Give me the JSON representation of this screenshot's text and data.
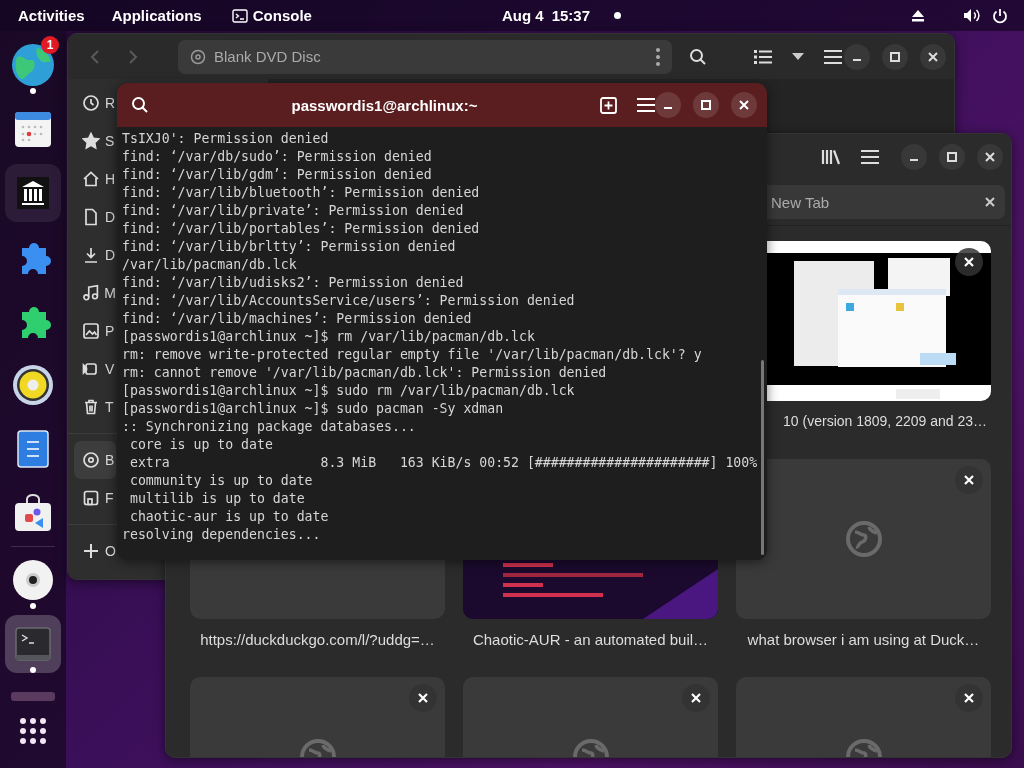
{
  "top_bar": {
    "activities": "Activities",
    "applications": "Applications",
    "app_name": "Console",
    "date": "Aug 4",
    "time": "15:37"
  },
  "dock": [
    {
      "kind": "globe",
      "running": true,
      "selected": false,
      "hovered": false,
      "badge": "1"
    },
    {
      "kind": "calendar",
      "running": false,
      "selected": false,
      "hovered": false
    },
    {
      "kind": "library",
      "running": false,
      "selected": false,
      "hovered": true
    },
    {
      "kind": "puzzle-blue",
      "running": false,
      "selected": false,
      "hovered": false
    },
    {
      "kind": "puzzle-green",
      "running": false,
      "selected": false,
      "hovered": false
    },
    {
      "kind": "speaker",
      "running": false,
      "selected": false,
      "hovered": false
    },
    {
      "kind": "notes",
      "running": false,
      "selected": false,
      "hovered": false
    },
    {
      "kind": "store",
      "running": false,
      "selected": false,
      "hovered": false
    },
    {
      "kind": "disc",
      "running": true,
      "selected": false,
      "hovered": false
    },
    {
      "kind": "terminal",
      "running": true,
      "selected": true,
      "hovered": false
    },
    {
      "kind": "stub",
      "running": false,
      "selected": false,
      "hovered": false
    }
  ],
  "files_window": {
    "location": "Blank DVD Disc",
    "sidebar": [
      [
        {
          "kind": "recent",
          "label": "R",
          "selected": false
        },
        {
          "kind": "starred",
          "label": "S",
          "selected": false
        },
        {
          "kind": "home",
          "label": "H",
          "selected": false
        },
        {
          "kind": "documents",
          "label": "D",
          "selected": false
        },
        {
          "kind": "downloads",
          "label": "D",
          "selected": false
        },
        {
          "kind": "music",
          "label": "M",
          "selected": false
        },
        {
          "kind": "pictures",
          "label": "P",
          "selected": false
        },
        {
          "kind": "videos",
          "label": "V",
          "selected": false
        },
        {
          "kind": "trash",
          "label": "T",
          "selected": false
        }
      ],
      [
        {
          "kind": "disc",
          "label": "B",
          "selected": true
        },
        {
          "kind": "floppy",
          "label": "F",
          "selected": false
        }
      ],
      [
        {
          "kind": "add",
          "label": "O",
          "selected": false
        }
      ]
    ]
  },
  "terminal": {
    "title": "passwordis1@archlinux:~",
    "lines": [
      "TsIXJ0': Permission denied",
      "find: ‘/var/db/sudo’: Permission denied",
      "find: ‘/var/lib/gdm’: Permission denied",
      "find: ‘/var/lib/bluetooth’: Permission denied",
      "find: ‘/var/lib/private’: Permission denied",
      "find: ‘/var/lib/portables’: Permission denied",
      "find: ‘/var/lib/brltty’: Permission denied",
      "/var/lib/pacman/db.lck",
      "find: ‘/var/lib/udisks2’: Permission denied",
      "find: ‘/var/lib/AccountsService/users’: Permission denied",
      "find: ‘/var/lib/machines’: Permission denied",
      "[passwordis1@archlinux ~]$ rm /var/lib/pacman/db.lck",
      "rm: remove write-protected regular empty file '/var/lib/pacman/db.lck'? y",
      "rm: cannot remove '/var/lib/pacman/db.lck': Permission denied",
      "[passwordis1@archlinux ~]$ sudo rm /var/lib/pacman/db.lck",
      "[passwordis1@archlinux ~]$ sudo pacman -Sy xdman",
      ":: Synchronizing package databases...",
      " core is up to date",
      " extra                   8.3 MiB   163 KiB/s 00:52 [######################] 100%",
      " community is up to date",
      " multilib is up to date",
      " chaotic-aur is up to date",
      "resolving dependencies..."
    ]
  },
  "browser": {
    "tab": {
      "label": "New Tab"
    },
    "tiles": [
      {
        "kind": "picture",
        "title": "10 (version 1809, 2209 and 23…"
      },
      {
        "kind": "blank",
        "title": "https://duckduckgo.com/l/?uddg=…"
      },
      {
        "kind": "picture",
        "title": "Chaotic-AUR - an automated buil…"
      },
      {
        "kind": "blank",
        "title": "what browser i am using at Duck…"
      },
      {
        "kind": "blank"
      },
      {
        "kind": "blank"
      },
      {
        "kind": "blank"
      }
    ]
  }
}
